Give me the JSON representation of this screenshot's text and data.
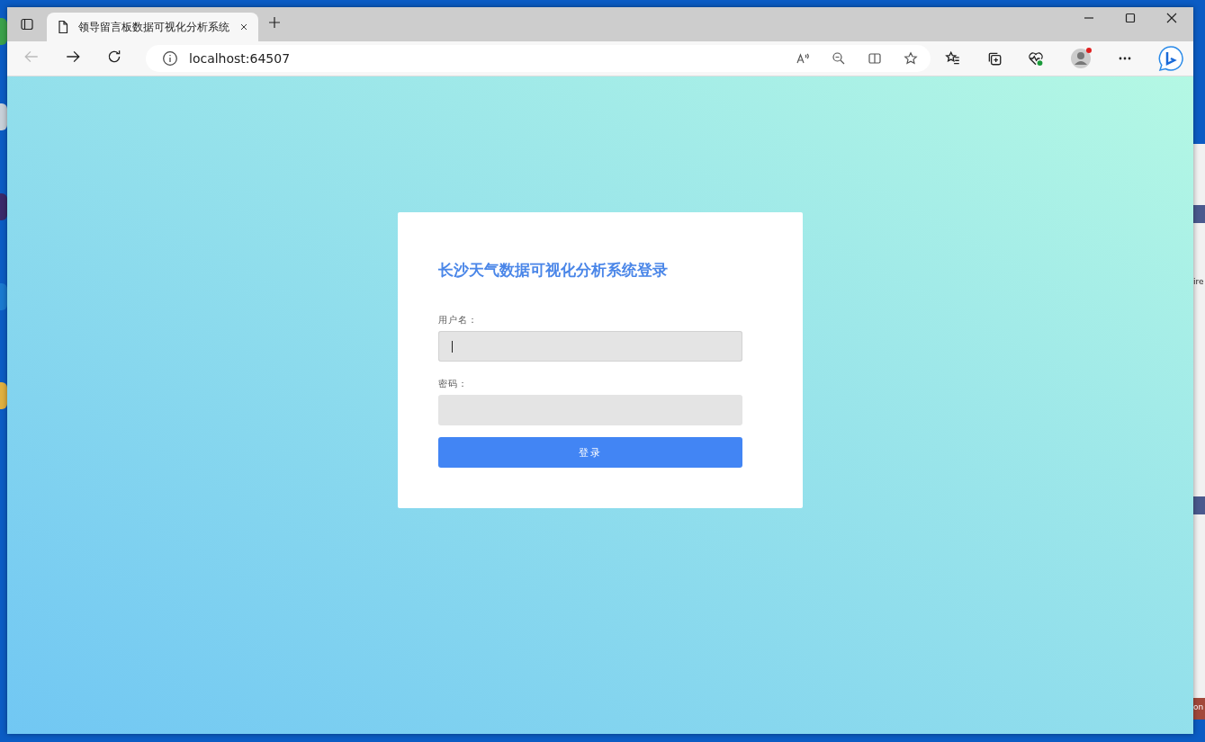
{
  "browser": {
    "tab": {
      "title": "领导留言板数据可视化分析系统",
      "selected": true
    },
    "address": "localhost:64507"
  },
  "login": {
    "title": "长沙天气数据可视化分析系统登录",
    "fields": [
      {
        "label": "用户名：",
        "focused": true
      },
      {
        "label": "密码：",
        "focused": false
      }
    ],
    "button": "登录"
  },
  "background_window": {
    "texts": [
      "ire",
      "on"
    ]
  }
}
